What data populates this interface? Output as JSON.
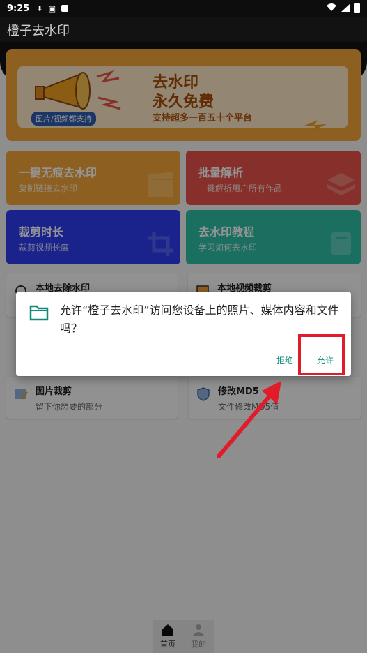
{
  "status_bar": {
    "time": "9:25"
  },
  "app": {
    "title": "橙子去水印"
  },
  "banner": {
    "headline_1": "去水印",
    "headline_2": "永久免费",
    "tag": "图片/视频都支持",
    "subline": "支持超多一百五十个平台"
  },
  "cards": [
    {
      "title": "一键无痕去水印",
      "subtitle": "复制链接去水印",
      "color": "#f3a53a"
    },
    {
      "title": "批量解析",
      "subtitle": "一键解析用户所有作品",
      "color": "#e8524a"
    },
    {
      "title": "裁剪时长",
      "subtitle": "裁剪视频长度",
      "color": "#2c3df0"
    },
    {
      "title": "去水印教程",
      "subtitle": "学习如何去水印",
      "color": "#2dbfa6"
    }
  ],
  "tools": [
    {
      "title": "本地去除水印",
      "subtitle": ""
    },
    {
      "title": "本地视频裁剪",
      "subtitle": ""
    },
    {
      "title": "图片裁剪",
      "subtitle": "留下你想要的部分"
    },
    {
      "title": "修改MD5",
      "subtitle": "文件修改MD5值"
    }
  ],
  "dialog": {
    "message": "允许“橙子去水印”访问您设备上的照片、媒体内容和文件吗？",
    "deny_label": "拒绝",
    "allow_label": "允许",
    "accent": "#0f8b7a"
  },
  "bottom_nav": [
    {
      "label": "首页",
      "icon": "home-icon"
    },
    {
      "label": "我的",
      "icon": "person-icon"
    }
  ],
  "highlight_color": "#e01c2a"
}
